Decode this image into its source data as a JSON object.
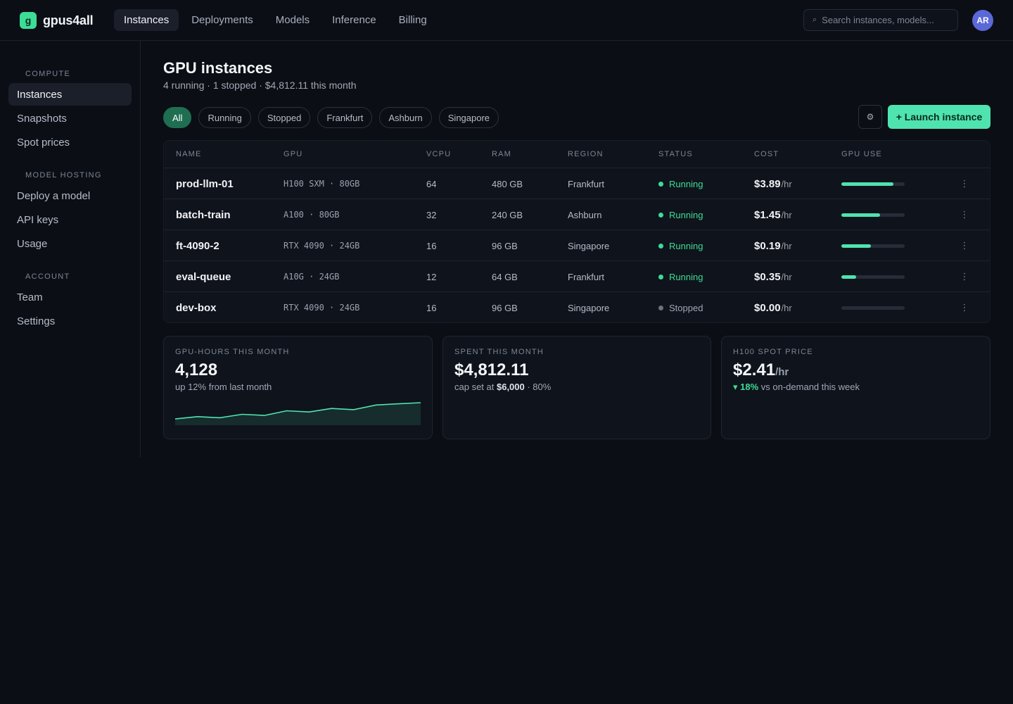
{
  "app": {
    "brand_letter": "g",
    "brand_name": "gpus4all",
    "user_initials": "AR"
  },
  "topnav": [
    {
      "label": "Instances",
      "active": true
    },
    {
      "label": "Deployments",
      "active": false
    },
    {
      "label": "Models",
      "active": false
    },
    {
      "label": "Inference",
      "active": false
    },
    {
      "label": "Billing",
      "active": false
    }
  ],
  "search": {
    "placeholder": "Search instances, models..."
  },
  "sidebar": {
    "sections": [
      {
        "title": "COMPUTE",
        "items": [
          {
            "label": "Instances",
            "active": true
          },
          {
            "label": "Snapshots"
          },
          {
            "label": "Spot prices"
          }
        ]
      },
      {
        "title": "MODEL HOSTING",
        "items": [
          {
            "label": "Deploy a model"
          },
          {
            "label": "API keys"
          },
          {
            "label": "Usage"
          }
        ]
      },
      {
        "title": "ACCOUNT",
        "items": [
          {
            "label": "Team"
          },
          {
            "label": "Settings"
          }
        ]
      }
    ]
  },
  "page": {
    "title": "GPU instances",
    "subtitle": "4 running · 1 stopped · $4,812.11 this month"
  },
  "filters": [
    {
      "label": "All",
      "active": true
    },
    {
      "label": "Running"
    },
    {
      "label": "Stopped"
    },
    {
      "label": "Frankfurt"
    },
    {
      "label": "Ashburn"
    },
    {
      "label": "Singapore"
    }
  ],
  "actions": {
    "launch_label": "+ Launch instance",
    "settings_icon": "gear-icon"
  },
  "table": {
    "headers": [
      "NAME",
      "GPU",
      "VCPU",
      "RAM",
      "REGION",
      "STATUS",
      "COST",
      "GPU USE"
    ],
    "rows": [
      {
        "name": "prod-llm-01",
        "gpu": "H100 SXM · 80GB",
        "vcpu": "64",
        "ram": "480 GB",
        "region": "Frankfurt",
        "status": "Running",
        "cost": "$3.89",
        "cost_unit": "/hr",
        "gpu_use": 0.82
      },
      {
        "name": "batch-train",
        "gpu": "A100 · 80GB",
        "vcpu": "32",
        "ram": "240 GB",
        "region": "Ashburn",
        "status": "Running",
        "cost": "$1.45",
        "cost_unit": "/hr",
        "gpu_use": 0.61
      },
      {
        "name": "ft-4090-2",
        "gpu": "RTX 4090 · 24GB",
        "vcpu": "16",
        "ram": "96 GB",
        "region": "Singapore",
        "status": "Running",
        "cost": "$0.19",
        "cost_unit": "/hr",
        "gpu_use": 0.47
      },
      {
        "name": "eval-queue",
        "gpu": "A10G · 24GB",
        "vcpu": "12",
        "ram": "64 GB",
        "region": "Frankfurt",
        "status": "Running",
        "cost": "$0.35",
        "cost_unit": "/hr",
        "gpu_use": 0.23
      },
      {
        "name": "dev-box",
        "gpu": "RTX 4090 · 24GB",
        "vcpu": "16",
        "ram": "96 GB",
        "region": "Singapore",
        "status": "Stopped",
        "cost": "$0.00",
        "cost_unit": "/hr",
        "gpu_use": 0
      }
    ]
  },
  "cards": {
    "gpu_hours": {
      "label": "GPU-HOURS THIS MONTH",
      "value": "4,128",
      "note": "up 12% from last month",
      "trend": [
        12,
        14,
        13,
        16,
        15,
        19,
        18,
        21,
        20,
        24,
        25,
        26
      ]
    },
    "spent": {
      "label": "SPENT THIS MONTH",
      "value": "$4,812.11",
      "note_prefix": "cap set at ",
      "cap": "$6,000",
      "note_suffix": " · 80%"
    },
    "spot": {
      "label": "H100 SPOT PRICE",
      "value": "$2.41",
      "unit": "/hr",
      "delta": "▾ 18%",
      "delta_note": " vs on-demand this week"
    }
  },
  "colors": {
    "accent": "#4fe3b0",
    "running": "#3ddc97",
    "stopped": "#6b7280",
    "chip_active": "#1f6e52",
    "avatar": "#5b68d8"
  }
}
